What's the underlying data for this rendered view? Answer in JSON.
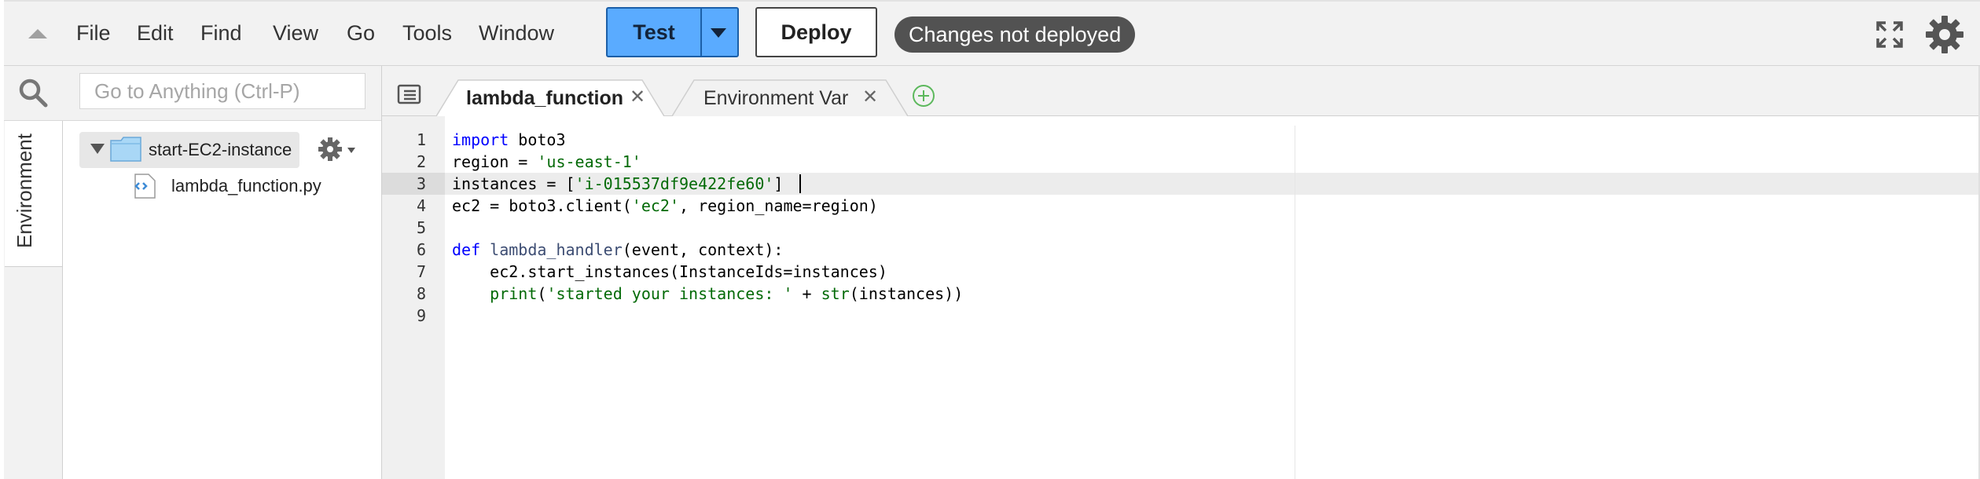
{
  "menubar": {
    "items": [
      "File",
      "Edit",
      "Find",
      "View",
      "Go",
      "Tools",
      "Window"
    ],
    "test_label": "Test",
    "deploy_label": "Deploy",
    "status_text": "Changes not deployed"
  },
  "search": {
    "placeholder": "Go to Anything (Ctrl-P)"
  },
  "sidebar": {
    "tab_label": "Environment",
    "folder_name": "start-EC2-instance",
    "file_name": "lambda_function.py"
  },
  "tabs": [
    {
      "label": "lambda_function",
      "active": true
    },
    {
      "label": "Environment Var",
      "active": false
    }
  ],
  "editor": {
    "line_numbers": [
      "1",
      "2",
      "3",
      "4",
      "5",
      "6",
      "7",
      "8",
      "9"
    ],
    "lines": [
      "import boto3",
      "region = 'us-east-1'",
      "instances = ['i-015537df9e422fe60']",
      "ec2 = boto3.client('ec2', region_name=region)",
      "",
      "def lambda_handler(event, context):",
      "    ec2.start_instances(InstanceIds=instances)",
      "    print('started your instances: ' + str(instances))",
      ""
    ],
    "active_line": 3
  },
  "colors": {
    "test_button": "#5aabff",
    "status_badge": "#525252",
    "keyword": "#0000ff",
    "string": "#036a07"
  },
  "icons": [
    "collapse-caret-icon",
    "fullscreen-icon",
    "gear-icon",
    "search-icon",
    "folder-icon",
    "python-file-icon",
    "tab-list-icon",
    "close-icon",
    "add-tab-icon"
  ]
}
